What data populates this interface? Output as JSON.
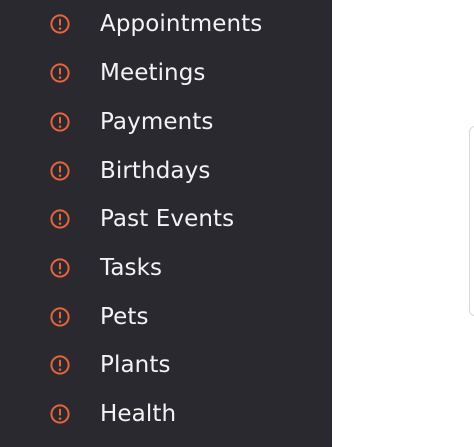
{
  "sidebar": {
    "accent_color": "#e8643a",
    "background_color": "#2b2930",
    "items": [
      {
        "label": "Appointments",
        "icon": "alert-circle-icon"
      },
      {
        "label": "Meetings",
        "icon": "alert-circle-icon"
      },
      {
        "label": "Payments",
        "icon": "alert-circle-icon"
      },
      {
        "label": "Birthdays",
        "icon": "alert-circle-icon"
      },
      {
        "label": "Past Events",
        "icon": "alert-circle-icon"
      },
      {
        "label": "Tasks",
        "icon": "alert-circle-icon"
      },
      {
        "label": "Pets",
        "icon": "alert-circle-icon"
      },
      {
        "label": "Plants",
        "icon": "alert-circle-icon"
      },
      {
        "label": "Health",
        "icon": "alert-circle-icon"
      }
    ]
  }
}
